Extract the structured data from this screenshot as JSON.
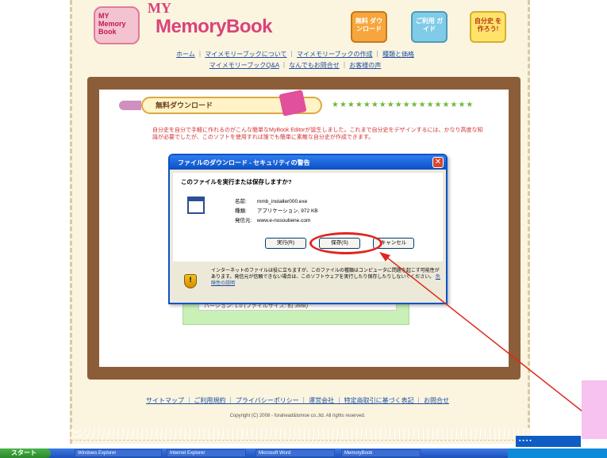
{
  "header": {
    "logo_badge": "MY Memory Book",
    "logo_my": "MY",
    "logo_title": "MemoryBook",
    "btn_download": "無料 ダウンロード",
    "btn_guide": "ご利用 ガイド",
    "btn_make": "自分史 を作ろう!"
  },
  "nav": {
    "row1": [
      "ホーム",
      "マイメモリーブックについて",
      "マイメモリーブックの作成",
      "種類と価格"
    ],
    "row2": [
      "マイメモリーブックQ&A",
      "なんでもお問合せ",
      "お客様の声"
    ]
  },
  "section": {
    "title": "無料ダウンロード",
    "stars": "★★★★★★★★★★★★★★★★★★",
    "intro": "自分史を自分で手軽に作れるのがこんな簡単なMyBook Editorが誕生しました。これまで自分史をデザインするには、かなり高度な知識が必要でしたが、このソフトを使用すれば誰でも簡単に素敵な自分史が作成できます。"
  },
  "green_note": "バージョン: 1.0 (ファイルサイズ: 約 3MB)",
  "footer": {
    "links": "サイトマップ ｜ ご利用規約 ｜ プライバシーポリシー ｜ 運営会社 ｜ 特定商取引に基づく表記 ｜ お問合せ",
    "copyright": "Copyright (C) 2008 - forahead&tomoe co.,ltd. All rights reserved."
  },
  "dialog": {
    "title": "ファイルのダウンロード - セキュリティの警告",
    "close": "✕",
    "question": "このファイルを実行または保存しますか?",
    "name_key": "名前:",
    "name_val": "mmb_installer000.exe",
    "type_key": "種類:",
    "type_val": "アプリケーション, 972 KB",
    "from_key": "発信元:",
    "from_val": "www.e-nosoubene.com",
    "btn_run": "実行(R)",
    "btn_save": "保存(S)",
    "btn_cancel": "キャンセル",
    "shield": "!",
    "warning": "インターネットのファイルは役に立ちますが、このファイルの種類はコンピュータに問題を起こす可能性があります。発信元が信頼できない場合は、このソフトウェアを実行したり保存したりしないでください。",
    "warning_link": "危険性の説明"
  },
  "taskbar": {
    "start": "スタート",
    "tasks": [
      "Windows Explorer",
      "Internet Explorer",
      "Microsoft Word",
      "MemoryBook"
    ]
  },
  "colors": {
    "accent": "#d9437a",
    "frame": "#8c5d39",
    "annotation": "#e0271f",
    "titlebar": "#0b4fc4"
  }
}
